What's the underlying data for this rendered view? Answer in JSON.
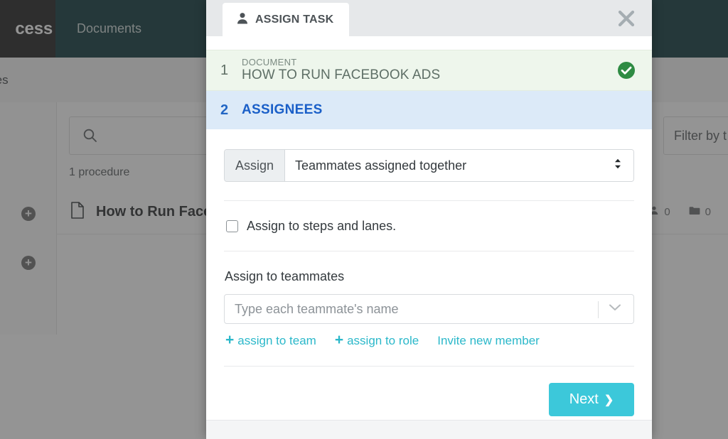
{
  "background": {
    "logo_text": "cess",
    "nav": [
      {
        "label": "Documents"
      }
    ],
    "breadcrumb": "res",
    "search_placeholder": "",
    "filter_label": "Filter by t",
    "procedure_count": "1 procedure",
    "document_row": {
      "title": "How to Run Facel",
      "stat_people": "0",
      "stat_folders": "0"
    }
  },
  "modal": {
    "tab_label": "ASSIGN TASK",
    "tab_icon": "person-icon",
    "close_icon": "close-icon",
    "steps": [
      {
        "number": "1",
        "kicker": "DOCUMENT",
        "title": "HOW TO RUN FACEBOOK ADS",
        "status_icon": "check-circle-icon"
      },
      {
        "number": "2",
        "title": "ASSIGNEES"
      }
    ],
    "assign": {
      "addon_label": "Assign",
      "selected_option": "Teammates assigned together",
      "options": [
        "Teammates assigned together"
      ]
    },
    "checkbox": {
      "label": "Assign to steps and lanes.",
      "checked": false
    },
    "teammates": {
      "field_label": "Assign to teammates",
      "placeholder": "Type each teammate's name",
      "value": "",
      "chevron_icon": "chevron-down-icon"
    },
    "links": [
      {
        "label": "assign to team",
        "icon": "plus-icon"
      },
      {
        "label": "assign to role",
        "icon": "plus-icon"
      },
      {
        "label": "Invite new member",
        "icon": ""
      }
    ],
    "next_button": {
      "label": "Next",
      "chevron": "❯"
    },
    "colors": {
      "accent_teal": "#3cc8da",
      "link_teal": "#2bb8ca",
      "step_active_blue": "#1a5fc8",
      "step_done_green": "#2e8b43",
      "header_dark": "#0a3338"
    }
  }
}
